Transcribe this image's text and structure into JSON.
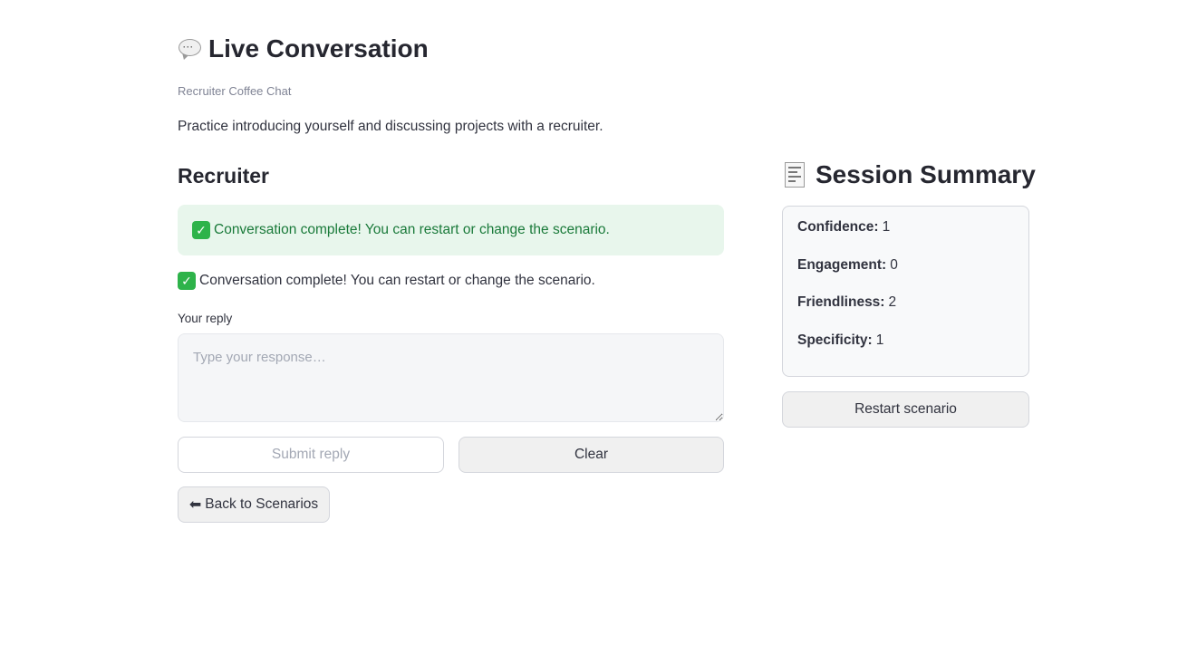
{
  "header": {
    "title": "Live Conversation",
    "title_icon": "speech-bubble-icon",
    "subtitle": "Recruiter Coffee Chat",
    "description": "Practice introducing yourself and discussing projects with a recruiter."
  },
  "conversation": {
    "heading": "Recruiter",
    "success_banner": "Conversation complete! You can restart or change the scenario.",
    "status_message": "Conversation complete! You can restart or change the scenario.",
    "check_icon": "check-mark-icon",
    "success_color": "#1a7a3a",
    "success_bg": "#e8f6ec"
  },
  "reply": {
    "label": "Your reply",
    "placeholder": "Type your response…",
    "value": ""
  },
  "actions": {
    "submit_label": "Submit reply",
    "clear_label": "Clear",
    "back_label": "Back to Scenarios",
    "back_icon": "arrow-left-icon"
  },
  "summary": {
    "title": "Session Summary",
    "title_icon": "receipt-icon",
    "metrics": [
      {
        "label": "Confidence:",
        "value": "1"
      },
      {
        "label": "Engagement:",
        "value": "0"
      },
      {
        "label": "Friendliness:",
        "value": "2"
      },
      {
        "label": "Specificity:",
        "value": "1"
      }
    ],
    "restart_label": "Restart scenario"
  }
}
